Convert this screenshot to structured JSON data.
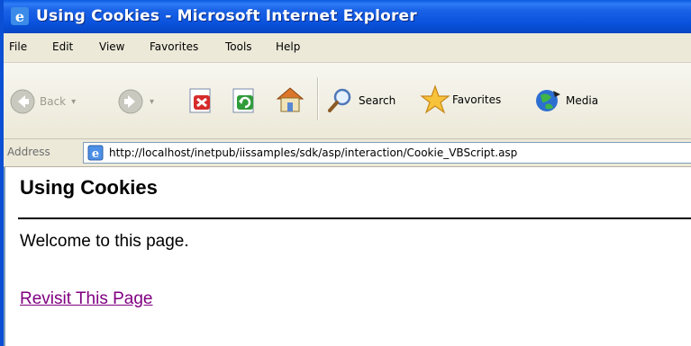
{
  "window": {
    "title": "Using Cookies - Microsoft Internet Explorer"
  },
  "menu": [
    "File",
    "Edit",
    "View",
    "Favorites",
    "Tools",
    "Help"
  ],
  "toolbar": {
    "back_label": "Back",
    "search_label": "Search",
    "favorites_label": "Favorites",
    "media_label": "Media"
  },
  "address": {
    "label": "Address",
    "url": "http://localhost/inetpub/iissamples/sdk/asp/interaction/Cookie_VBScript.asp"
  },
  "page": {
    "heading": "Using Cookies",
    "welcome": "Welcome to this page.",
    "link": "Revisit This Page"
  },
  "colors": {
    "titlebar": "#0a52dc",
    "chrome": "#ece9d8",
    "visited_link": "#800080"
  }
}
